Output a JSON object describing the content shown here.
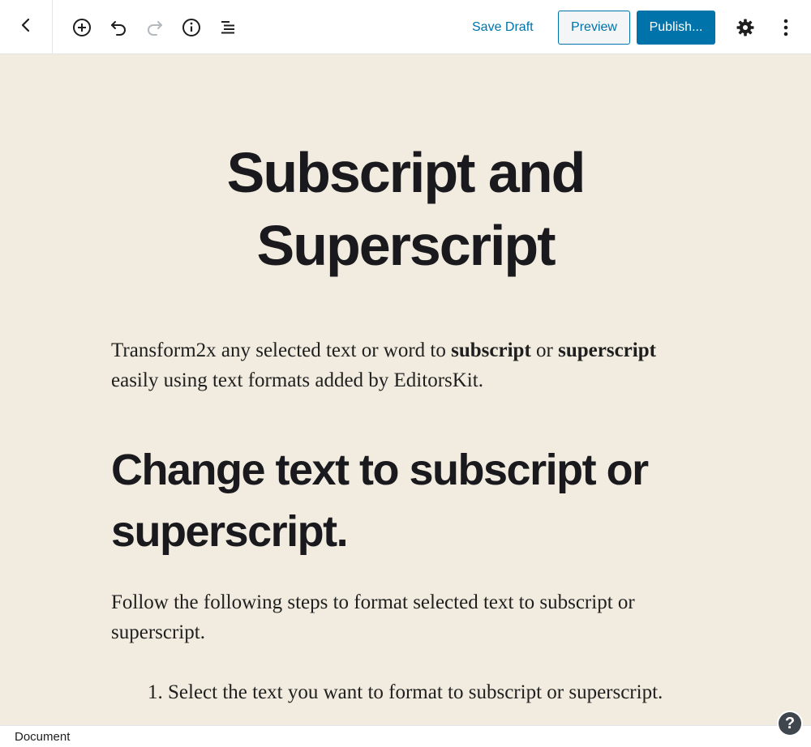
{
  "toolbar": {
    "back_icon": "chevron-left-icon",
    "tools": [
      {
        "name": "add-block-icon"
      },
      {
        "name": "undo-icon"
      },
      {
        "name": "redo-icon"
      },
      {
        "name": "info-icon"
      },
      {
        "name": "block-navigation-icon"
      }
    ],
    "save_draft_label": "Save Draft",
    "preview_label": "Preview",
    "publish_label": "Publish...",
    "settings_icon": "gear-icon",
    "more_icon": "more-vertical-icon"
  },
  "content": {
    "title": "Subscript and Superscript",
    "intro": {
      "part1": "Transform2x any selected text or word to ",
      "bold1": "subscript",
      "part2": " or ",
      "bold2": "superscript",
      "part3": " easily using text formats added by EditorsKit."
    },
    "heading": "Change text to subscript or superscript.",
    "steps_intro": "Follow the following steps to format selected text to subscript or superscript.",
    "steps": [
      {
        "num": "1.",
        "text": "Select the text you want to format to subscript or superscript."
      }
    ]
  },
  "footer": {
    "breadcrumb": "Document",
    "help_label": "?"
  },
  "colors": {
    "accent": "#0073aa",
    "background": "#f1ecdf",
    "text": "#1a1a1e"
  }
}
